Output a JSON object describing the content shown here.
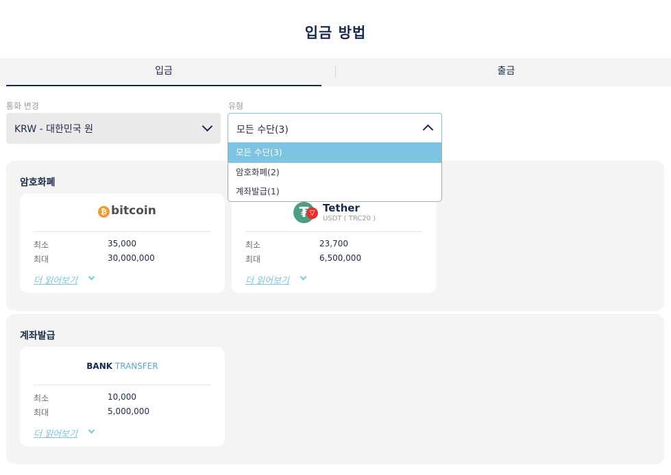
{
  "page": {
    "title": "입금 방법"
  },
  "tabs": [
    {
      "label": "입금",
      "active": true
    },
    {
      "label": "출금",
      "active": false
    }
  ],
  "filters": {
    "currency": {
      "label": "통화 변경",
      "value": "KRW - 대한민국 원"
    },
    "type": {
      "label": "유형",
      "value": "모든 수단(3)",
      "expanded": true,
      "options": [
        "모든 수단(3)",
        "암호화폐(2)",
        "계좌발급(1)"
      ],
      "selected_index": 0
    }
  },
  "sections": [
    {
      "title": "암호화폐",
      "cards": [
        {
          "logo": {
            "name": "bitcoin",
            "icon": "bitcoin-icon"
          },
          "min_label": "최소",
          "min": "35,000",
          "max_label": "최대",
          "max": "30,000,000",
          "read_more": "더 읽어보기"
        },
        {
          "logo": {
            "name": "Tether",
            "sub": "USDT ( TRC20 )",
            "icon": "tether-icon"
          },
          "min_label": "최소",
          "min": "23,700",
          "max_label": "최대",
          "max": "6,500,000",
          "read_more": "더 읽어보기"
        }
      ]
    },
    {
      "title": "계좌발급",
      "cards": [
        {
          "logo": {
            "part1": "BANK",
            "part2": "TRANSFER"
          },
          "min_label": "최소",
          "min": "10,000",
          "max_label": "최대",
          "max": "5,000,000",
          "read_more": "더 읽어보기"
        }
      ]
    }
  ],
  "colors": {
    "navy": "#17284f",
    "accent": "#7cc4e1",
    "bitcoin": "#f39a2c",
    "tether": "#4c9d82",
    "tron": "#e8312e"
  }
}
